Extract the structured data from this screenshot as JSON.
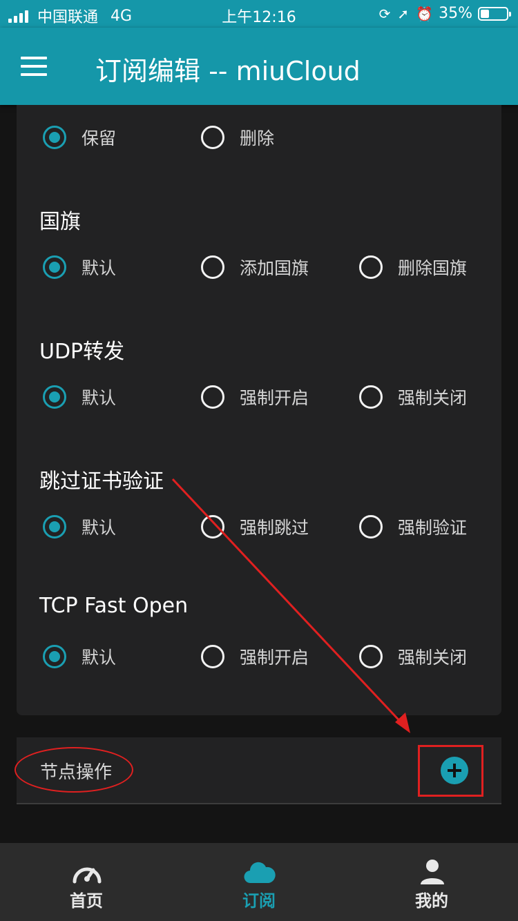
{
  "status_bar": {
    "carrier": "中国联通",
    "network": "4G",
    "time": "上午12:16",
    "battery": "35%"
  },
  "appbar": {
    "title": "订阅编辑 -- miuCloud"
  },
  "settings": {
    "first_row": {
      "options": [
        "保留",
        "删除"
      ],
      "selected": 0
    },
    "sections": [
      {
        "title": "国旗",
        "options": [
          "默认",
          "添加国旗",
          "删除国旗"
        ],
        "selected": 0
      },
      {
        "title": "UDP转发",
        "options": [
          "默认",
          "强制开启",
          "强制关闭"
        ],
        "selected": 0
      },
      {
        "title": "跳过证书验证",
        "options": [
          "默认",
          "强制跳过",
          "强制验证"
        ],
        "selected": 0
      },
      {
        "title": "TCP Fast Open",
        "options": [
          "默认",
          "强制开启",
          "强制关闭"
        ],
        "selected": 0
      }
    ]
  },
  "node_ops": {
    "title": "节点操作"
  },
  "bottom_nav": {
    "items": [
      {
        "label": "首页",
        "icon": "speedometer-icon"
      },
      {
        "label": "订阅",
        "icon": "cloud-icon"
      },
      {
        "label": "我的",
        "icon": "user-icon"
      }
    ],
    "active": 1
  },
  "colors": {
    "accent": "#1a9fb2",
    "appbar": "#1597a9",
    "annotation": "#e02020"
  }
}
